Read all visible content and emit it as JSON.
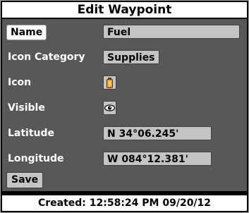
{
  "title": "Edit Waypoint",
  "fields": {
    "name": {
      "label": "Name",
      "value": "Fuel"
    },
    "icon_category": {
      "label": "Icon Category",
      "value": "Supplies"
    },
    "icon": {
      "label": "Icon",
      "icon": "fuel-can-icon"
    },
    "visible": {
      "label": "Visible",
      "icon": "eye-icon"
    },
    "latitude": {
      "label": "Latitude",
      "value": "N 34°06.245'"
    },
    "longitude": {
      "label": "Longitude",
      "value": "W 084°12.381'"
    }
  },
  "save_label": "Save",
  "footer": "Created: 12:58:24 PM 09/20/12",
  "colors": {
    "panel": "#585858",
    "field": "#c4c4c4",
    "highlight": "#ffffff",
    "fuel_icon": "#e8a020"
  }
}
